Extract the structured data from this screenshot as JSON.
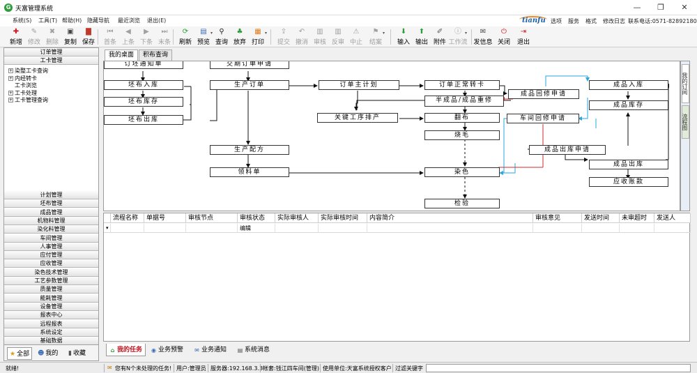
{
  "window": {
    "title": "天富管理系统",
    "icon_glyph": "G",
    "minimize": "—",
    "restore": "❐",
    "close": "✕"
  },
  "menu": {
    "items": [
      "系统(S)",
      "工具(T)",
      "帮助(H)",
      "隐藏导航",
      "最近浏览",
      "退出(E)"
    ]
  },
  "header": {
    "logo": "tianfu",
    "links": [
      "选项",
      "服务",
      "格式",
      "修改日志"
    ],
    "phone": "联系电话:0571-82892180"
  },
  "toolbar": {
    "buttons": [
      {
        "label": "新增",
        "icon": "plus-icon",
        "glyph": "✚",
        "color": "#d0161c",
        "enabled": true
      },
      {
        "label": "修改",
        "icon": "edit-icon",
        "glyph": "✎",
        "color": "#a0a0a0",
        "enabled": false
      },
      {
        "label": "删除",
        "icon": "delete-icon",
        "glyph": "✖",
        "color": "#a0a0a0",
        "enabled": false
      },
      {
        "label": "复制",
        "icon": "copy-icon",
        "glyph": "▣",
        "color": "#444444",
        "enabled": true
      },
      {
        "label": "保存",
        "icon": "save-icon",
        "glyph": "▇",
        "color": "#c0392b",
        "enabled": true
      },
      {
        "label": "首条",
        "icon": "first-icon",
        "glyph": "⏮",
        "color": "#a0a0a0",
        "enabled": false
      },
      {
        "label": "上条",
        "icon": "prev-icon",
        "glyph": "◀",
        "color": "#a0a0a0",
        "enabled": false
      },
      {
        "label": "下条",
        "icon": "next-icon",
        "glyph": "▶",
        "color": "#a0a0a0",
        "enabled": false
      },
      {
        "label": "末条",
        "icon": "last-icon",
        "glyph": "⏭",
        "color": "#a0a0a0",
        "enabled": false
      },
      {
        "label": "刷新",
        "icon": "refresh-icon",
        "glyph": "⟳",
        "color": "#2e9d3a",
        "enabled": true
      },
      {
        "label": "预览",
        "icon": "preview-icon",
        "glyph": "▤",
        "color": "#3b6cb5",
        "enabled": true
      },
      {
        "label": "查询",
        "icon": "search-icon",
        "glyph": "⚲",
        "color": "#222222",
        "enabled": true
      },
      {
        "label": "放弃",
        "icon": "abandon-icon",
        "glyph": "♣",
        "color": "#2e9d3a",
        "enabled": true
      },
      {
        "label": "打印",
        "icon": "print-icon",
        "glyph": "▦",
        "color": "#e07b1a",
        "enabled": true
      },
      {
        "label": "提交",
        "icon": "submit-icon",
        "glyph": "⇪",
        "color": "#a0a0a0",
        "enabled": false
      },
      {
        "label": "撤消",
        "icon": "undo-icon",
        "glyph": "↶",
        "color": "#a0a0a0",
        "enabled": false
      },
      {
        "label": "审核",
        "icon": "audit-icon",
        "glyph": "▥",
        "color": "#a0a0a0",
        "enabled": false
      },
      {
        "label": "反审",
        "icon": "unaudit-icon",
        "glyph": "▥",
        "color": "#a0a0a0",
        "enabled": false
      },
      {
        "label": "中止",
        "icon": "stop-icon",
        "glyph": "⚠",
        "color": "#a0a0a0",
        "enabled": false
      },
      {
        "label": "结案",
        "icon": "close-case-icon",
        "glyph": "⚑",
        "color": "#a0a0a0",
        "enabled": false
      },
      {
        "label": "输入",
        "icon": "import-icon",
        "glyph": "⬇",
        "color": "#2e9d3a",
        "enabled": true
      },
      {
        "label": "输出",
        "icon": "export-icon",
        "glyph": "⬆",
        "color": "#2e9d3a",
        "enabled": true
      },
      {
        "label": "附件",
        "icon": "attachment-icon",
        "glyph": "✐",
        "color": "#555555",
        "enabled": true
      },
      {
        "label": "工作流",
        "icon": "workflow-icon",
        "glyph": "ⓘ",
        "color": "#a0a0a0",
        "enabled": false
      },
      {
        "label": "发信息",
        "icon": "message-icon",
        "glyph": "✉",
        "color": "#444444",
        "enabled": true
      },
      {
        "label": "关闭",
        "icon": "close-window-icon",
        "glyph": "⏻",
        "color": "#d0161c",
        "enabled": true
      },
      {
        "label": "退出",
        "icon": "exit-icon",
        "glyph": "⇥",
        "color": "#d0161c",
        "enabled": true
      }
    ]
  },
  "left": {
    "top_headers": [
      "订单管理",
      "工卡管理"
    ],
    "tree": [
      {
        "label": "染整工卡查询",
        "expandable": true
      },
      {
        "label": "内经转卡",
        "expandable": true
      },
      {
        "label": "工卡浏览",
        "expandable": false
      },
      {
        "label": "工卡处理",
        "expandable": true
      },
      {
        "label": "工卡管理查询",
        "expandable": true
      }
    ],
    "modules": [
      "计划管理",
      "坯布管理",
      "成品管理",
      "机物料管理",
      "染化料管理",
      "车间管理",
      "人事管理",
      "应付管理",
      "应收管理",
      "染色技术管理",
      "工艺参数管理",
      "质量管理",
      "能耗管理",
      "设备管理",
      "报表中心",
      "远程报表",
      "系统设定",
      "基础数据"
    ],
    "bottom_tabs": [
      {
        "label": "全部",
        "icon": "star-icon",
        "glyph": "★"
      },
      {
        "label": "我的",
        "icon": "user-icon",
        "glyph": "☻"
      },
      {
        "label": "收藏",
        "icon": "favorite-icon",
        "glyph": "▮"
      }
    ]
  },
  "tabs": [
    "我的桌面",
    "积布查询"
  ],
  "flow": {
    "nodes": {
      "n1": "订坯通知单",
      "n2": "坯布入库",
      "n3": "坯布库存",
      "n4": "坯布出库",
      "n5": "交期订单申请",
      "n6": "生产订单",
      "n7": "生产配方",
      "n8": "领料单",
      "n9": "订单主计划",
      "n10": "关键工序排产",
      "n11": "订单正常转卡",
      "n12": "半成品/成品重修",
      "n13": "翻布",
      "n14": "烧毛",
      "n15": "染色",
      "n16": "检验",
      "n17": "成品回修申请",
      "n18": "车间回修申请",
      "n19": "成品入库",
      "n20": "成品库存",
      "n21": "成品出库申请",
      "n22": "成品出库",
      "n23": "应收账款"
    },
    "side_tabs": [
      "我的订阅",
      "流程图"
    ]
  },
  "grid": {
    "columns": [
      "流程名称",
      "单据号",
      "审核节点",
      "审核状态",
      "实际审核人",
      "实际审核时间",
      "内容简介",
      "审核意见",
      "发送时间",
      "未审超时",
      "发送人"
    ],
    "rows": [
      [
        "",
        "",
        "",
        "编辑",
        "",
        "",
        "",
        "",
        "",
        "",
        ""
      ]
    ],
    "row_marker": "▾"
  },
  "bottom_tabs": [
    {
      "label": "我的任务",
      "icon": "home-icon",
      "glyph": "⌂"
    },
    {
      "label": "业务预警",
      "icon": "warning-icon",
      "glyph": "◉"
    },
    {
      "label": "业务通知",
      "icon": "mail-icon",
      "glyph": "✉"
    },
    {
      "label": "系统消息",
      "icon": "system-message-icon",
      "glyph": "▤"
    }
  ],
  "status": {
    "ready": "就绪!",
    "tasks": "您有N个未处理的任务!",
    "user": "用户:管理员",
    "server": "服务器:192.168.3.3",
    "account": "帐套:钱江四车间(管理)",
    "unit": "使用单位:天富系统授权客户",
    "filter_label": "过滤关键字"
  },
  "colors": {
    "flow_blue": "#2aa7df",
    "flow_red": "#d12a2a",
    "accent_red": "#c1121f"
  }
}
